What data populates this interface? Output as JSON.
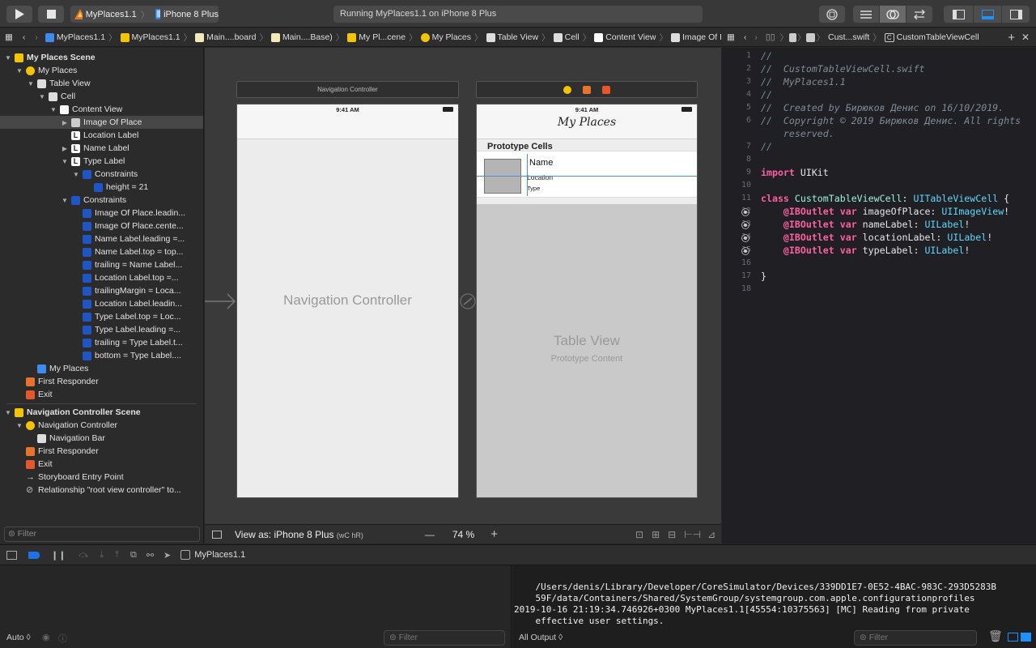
{
  "toolbar": {
    "scheme_app": "MyPlaces1.1",
    "scheme_device": "iPhone 8 Plus",
    "activity": "Running MyPlaces1.1 on iPhone 8 Plus"
  },
  "jumpbar_left": [
    "MyPlaces1.1",
    "MyPlaces1.1",
    "Main....board",
    "Main....Base)",
    "My Pl...cene",
    "My Places",
    "Table View",
    "Cell",
    "Content View",
    "Image Of Place"
  ],
  "jumpbar_right": [
    "Cust...swift",
    "CustomTableViewCell"
  ],
  "outline": [
    {
      "label": "My Places Scene",
      "depth": 0,
      "open": true,
      "bold": true,
      "icon": "scene"
    },
    {
      "label": "My Places",
      "depth": 1,
      "open": true,
      "icon": "vc"
    },
    {
      "label": "Table View",
      "depth": 2,
      "open": true,
      "icon": "tableview"
    },
    {
      "label": "Cell",
      "depth": 3,
      "open": true,
      "icon": "cell"
    },
    {
      "label": "Content View",
      "depth": 4,
      "open": true,
      "icon": "view"
    },
    {
      "label": "Image Of Place",
      "depth": 5,
      "open": false,
      "icon": "imageview",
      "selected": true
    },
    {
      "label": "Location Label",
      "depth": 5,
      "icon": "label"
    },
    {
      "label": "Name Label",
      "depth": 5,
      "open": false,
      "icon": "label"
    },
    {
      "label": "Type Label",
      "depth": 5,
      "open": true,
      "icon": "label"
    },
    {
      "label": "Constraints",
      "depth": 6,
      "open": true,
      "icon": "constraints"
    },
    {
      "label": "height = 21",
      "depth": 7,
      "icon": "constraint"
    },
    {
      "label": "Constraints",
      "depth": 5,
      "open": true,
      "icon": "constraints"
    },
    {
      "label": "Image Of Place.leadin...",
      "depth": 6,
      "icon": "constraint"
    },
    {
      "label": "Image Of Place.cente...",
      "depth": 6,
      "icon": "constraint"
    },
    {
      "label": "Name Label.leading =...",
      "depth": 6,
      "icon": "constraint"
    },
    {
      "label": "Name Label.top = top...",
      "depth": 6,
      "icon": "constraint"
    },
    {
      "label": "trailing = Name Label...",
      "depth": 6,
      "icon": "constraint"
    },
    {
      "label": "Location Label.top =...",
      "depth": 6,
      "icon": "constraint"
    },
    {
      "label": "trailingMargin = Loca...",
      "depth": 6,
      "icon": "constraint"
    },
    {
      "label": "Location Label.leadin...",
      "depth": 6,
      "icon": "constraint"
    },
    {
      "label": "Type Label.top = Loc...",
      "depth": 6,
      "icon": "constraint"
    },
    {
      "label": "Type Label.leading =...",
      "depth": 6,
      "icon": "constraint"
    },
    {
      "label": "trailing = Type Label.t...",
      "depth": 6,
      "icon": "constraint"
    },
    {
      "label": "bottom = Type Label....",
      "depth": 6,
      "icon": "constraint"
    },
    {
      "label": "My Places",
      "depth": 2,
      "icon": "navitem"
    },
    {
      "label": "First Responder",
      "depth": 1,
      "icon": "responder"
    },
    {
      "label": "Exit",
      "depth": 1,
      "icon": "exit"
    },
    {
      "label": "Navigation Controller Scene",
      "depth": 0,
      "open": true,
      "bold": true,
      "icon": "scene",
      "gap": true
    },
    {
      "label": "Navigation Controller",
      "depth": 1,
      "open": true,
      "icon": "navcontroller"
    },
    {
      "label": "Navigation Bar",
      "depth": 2,
      "icon": "navbar"
    },
    {
      "label": "First Responder",
      "depth": 1,
      "icon": "responder"
    },
    {
      "label": "Exit",
      "depth": 1,
      "icon": "exit"
    },
    {
      "label": "Storyboard Entry Point",
      "depth": 1,
      "icon": "arrow"
    },
    {
      "label": "Relationship \"root view controller\" to...",
      "depth": 1,
      "icon": "relationship"
    }
  ],
  "nav_filter_placeholder": "Filter",
  "canvas": {
    "nav_scene_title": "Navigation Controller",
    "time": "9:41 AM",
    "nav_controller_label": "Navigation Controller",
    "nav_title": "My Places",
    "prototype_cells": "Prototype Cells",
    "cell_name": "Name",
    "cell_location": "Location",
    "cell_type": "Type",
    "table_view": "Table View",
    "prototype_content": "Prototype Content",
    "view_as": "View as: iPhone 8 Plus",
    "size_class": "(wC hR)",
    "zoom": "74 %",
    "zoom_out": "—",
    "zoom_in": "+"
  },
  "code": [
    {
      "n": "1",
      "t": "//"
    },
    {
      "n": "2",
      "t": "//  CustomTableViewCell.swift"
    },
    {
      "n": "3",
      "t": "//  MyPlaces1.1"
    },
    {
      "n": "4",
      "t": "//"
    },
    {
      "n": "5",
      "t": "//  Created by Бирюков Денис on 16/10/2019."
    },
    {
      "n": "6",
      "t": "//  Copyright © 2019 Бирюков Денис. All rights"
    },
    {
      "n": "",
      "t": "    reserved."
    },
    {
      "n": "7",
      "t": "//"
    },
    {
      "n": "8",
      "t": ""
    },
    {
      "n": "9",
      "t": "import UIKit"
    },
    {
      "n": "10",
      "t": ""
    },
    {
      "n": "11",
      "t": "class CustomTableViewCell: UITableViewCell {"
    },
    {
      "n": "12",
      "t": "    @IBOutlet var imageOfPlace: UIImageView!"
    },
    {
      "n": "13",
      "t": "    @IBOutlet var nameLabel: UILabel!"
    },
    {
      "n": "14",
      "t": "    @IBOutlet var locationLabel: UILabel!"
    },
    {
      "n": "15",
      "t": "    @IBOutlet var typeLabel: UILabel!"
    },
    {
      "n": "16",
      "t": ""
    },
    {
      "n": "17",
      "t": "}"
    },
    {
      "n": "18",
      "t": ""
    }
  ],
  "debug": {
    "target": "MyPlaces1.1",
    "auto": "Auto ◊",
    "filter": "Filter",
    "all_output": "All Output ◊",
    "console_lines": [
      "    /Users/denis/Library/Developer/CoreSimulator/Devices/339DD1E7-0E52-4BAC-983C-293D5283B",
      "    59F/data/Containers/Shared/SystemGroup/systemgroup.com.apple.configurationprofiles",
      "2019-10-16 21:19:34.746926+0300 MyPlaces1.1[45554:10375563] [MC] Reading from private",
      "    effective user settings."
    ]
  },
  "colors": {
    "accent": "#0a84ff",
    "keyword": "#fc5fa3",
    "type": "#5dd8ff",
    "comment": "#7f8c98"
  }
}
